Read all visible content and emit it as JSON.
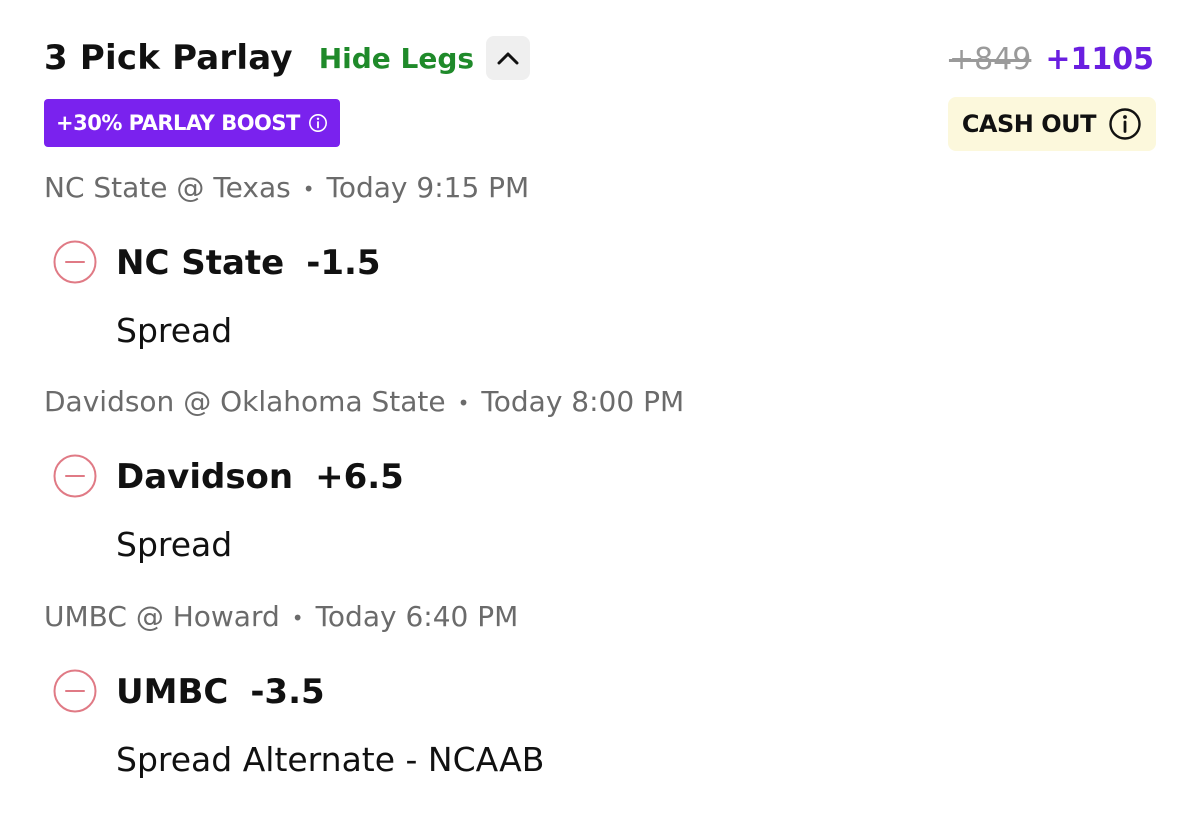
{
  "header": {
    "title": "3 Pick Parlay",
    "toggle_label": "Hide Legs",
    "chevron_icon": "chevron-up-icon",
    "odds_original": "+849",
    "odds_boosted": "+1105",
    "boost_label": "+30% PARLAY BOOST",
    "cashout_label": "CASH OUT"
  },
  "colors": {
    "toggle": "#1f8a2a",
    "boost_bg": "#7a22ee",
    "odds_boosted": "#6a1fe0",
    "cashout_bg": "#fcf8dc",
    "remove_icon": "#e07a85"
  },
  "legs": [
    {
      "matchup": "NC State @ Texas",
      "time": "Today 9:15 PM",
      "pick": "NC State",
      "line": "-1.5",
      "market": "Spread",
      "icon": "remove-icon"
    },
    {
      "matchup": "Davidson @ Oklahoma State",
      "time": "Today 8:00 PM",
      "pick": "Davidson",
      "line": "+6.5",
      "market": "Spread",
      "icon": "remove-icon"
    },
    {
      "matchup": "UMBC @ Howard",
      "time": "Today 6:40 PM",
      "pick": "UMBC",
      "line": "-3.5",
      "market": "Spread Alternate - NCAAB",
      "icon": "remove-icon"
    }
  ]
}
